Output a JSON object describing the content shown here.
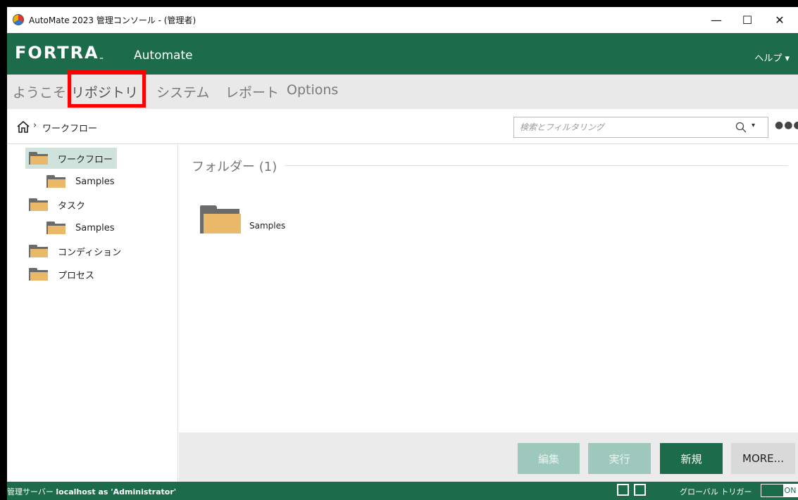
{
  "window": {
    "title": "AutoMate 2023 管理コンソール - (管理者)",
    "minimize": "—",
    "maximize": "☐",
    "close": "✕"
  },
  "brand": {
    "logo": "FORTRA",
    "logo_tm": "™",
    "app_name": "Automate",
    "help_menu": "ヘルプ ▾"
  },
  "tabs": [
    {
      "label": "ようこそ",
      "active": false
    },
    {
      "label": "リポジトリ",
      "active": true
    },
    {
      "label": "システム",
      "active": false
    },
    {
      "label": "レポート",
      "active": false
    },
    {
      "label": "Options",
      "active": false
    }
  ],
  "breadcrumb": {
    "separator": "›",
    "current": "ワークフロー"
  },
  "search": {
    "placeholder": "検索とフィルタリング",
    "dropdown": "▾",
    "more": "●●●"
  },
  "tree": [
    {
      "label": "ワークフロー",
      "level": 0,
      "selected": true
    },
    {
      "label": "Samples",
      "level": 1,
      "selected": false
    },
    {
      "label": "タスク",
      "level": 0,
      "selected": false
    },
    {
      "label": "Samples",
      "level": 1,
      "selected": false
    },
    {
      "label": "コンディション",
      "level": 0,
      "selected": false
    },
    {
      "label": "プロセス",
      "level": 0,
      "selected": false
    }
  ],
  "content": {
    "section_title": "フォルダー (1)",
    "folders": [
      {
        "label": "Samples"
      }
    ]
  },
  "actions": {
    "edit": "編集",
    "run": "実行",
    "new": "新規",
    "more": "MORE..."
  },
  "status": {
    "server_label": "管理サーバー",
    "connection": "localhost as 'Administrator'",
    "global_trigger": "グローバル トリガー",
    "toggle": "ON"
  },
  "colors": {
    "brand_green": "#1c6b4a",
    "highlight_red": "#ff0000",
    "folder_yellow": "#e9b868"
  }
}
